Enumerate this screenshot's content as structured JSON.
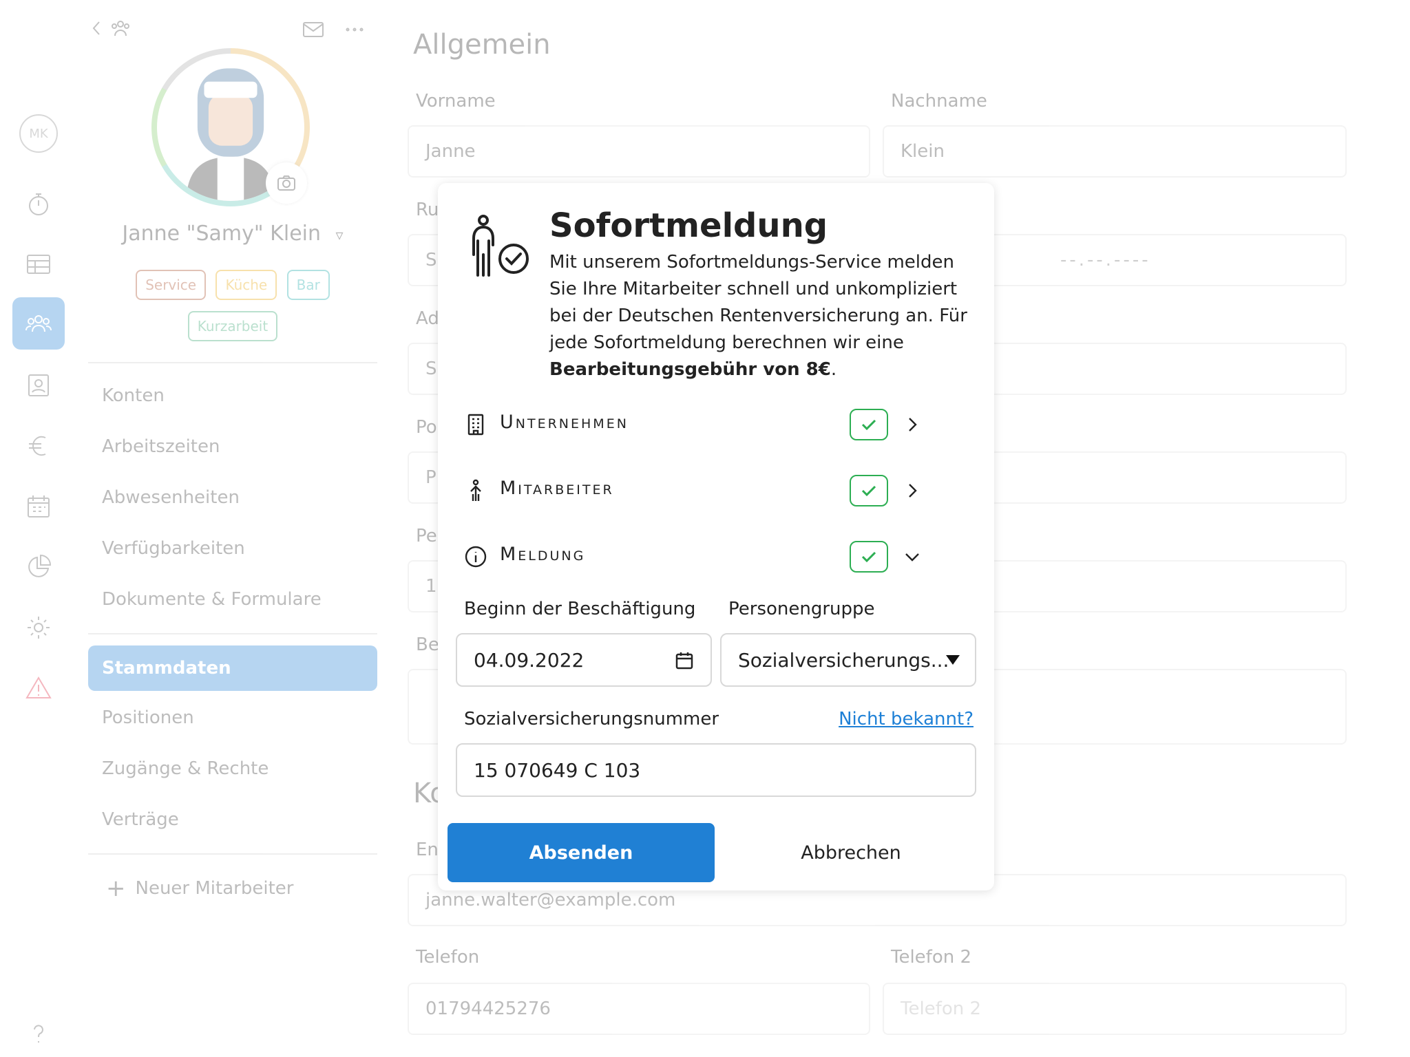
{
  "rail": {
    "avatar_initials": "MK",
    "icons": [
      "stopwatch-icon",
      "table-icon",
      "employees-icon",
      "contact-card-icon",
      "euro-icon",
      "calendar-icon",
      "pie-chart-icon",
      "gear-icon",
      "warning-icon",
      "help-icon"
    ]
  },
  "profile": {
    "name": "Janne \"Samy\" Klein",
    "tags": [
      "Service",
      "Küche",
      "Bar",
      "Kurzarbeit"
    ],
    "menu": [
      "Konten",
      "Arbeitszeiten",
      "Abwesenheiten",
      "Verfügbarkeiten",
      "Dokumente & Formulare"
    ],
    "menu2": [
      "Stammdaten",
      "Positionen",
      "Zugänge & Rechte",
      "Verträge"
    ],
    "active_item": "Stammdaten",
    "new_employee": "Neuer Mitarbeiter"
  },
  "form": {
    "section_general": "Allgemein",
    "vorname_label": "Vorname",
    "vorname_value": "Janne",
    "nachname_label": "Nachname",
    "nachname_value": "Klein",
    "date_placeholder": "--.--.----",
    "email_value": "janne.walter@example.com",
    "telefon_label": "Telefon",
    "telefon_value": "01794425276",
    "telefon2_label": "Telefon 2",
    "telefon2_placeholder": "Telefon 2",
    "partial_labels": [
      "Ru",
      "Ad",
      "Po",
      "Pe",
      "Be",
      "Ko",
      "En"
    ],
    "partial_values": [
      "S",
      "S",
      "P",
      "1"
    ]
  },
  "modal": {
    "title": "Sofortmeldung",
    "description": "Mit unserem Sofortmeldungs-Service melden Sie Ihre Mitarbeiter schnell und unkompliziert bei der Deutschen Rentenversicherung an. Für jede Sofortmeldung berechnen wir eine",
    "description_bold": "Bearbeitungsgebühr von 8€",
    "description_end": ".",
    "steps": [
      {
        "label": "Unternehmen",
        "icon": "building-icon",
        "done": true,
        "expanded": false
      },
      {
        "label": "Mitarbeiter",
        "icon": "person-icon",
        "done": true,
        "expanded": false
      },
      {
        "label": "Meldung",
        "icon": "info-icon",
        "done": true,
        "expanded": true
      }
    ],
    "start_label": "Beginn der Beschäftigung",
    "start_value": "04.09.2022",
    "group_label": "Personengruppe",
    "group_value": "Sozialversicherungs...",
    "ssn_label": "Sozialversicherungsnummer",
    "ssn_link": "Nicht bekannt?",
    "ssn_value": "15 070649 C 103",
    "submit": "Absenden",
    "cancel": "Abbrechen",
    "colors": {
      "primary": "#2080d4",
      "success": "#2cae52"
    }
  }
}
